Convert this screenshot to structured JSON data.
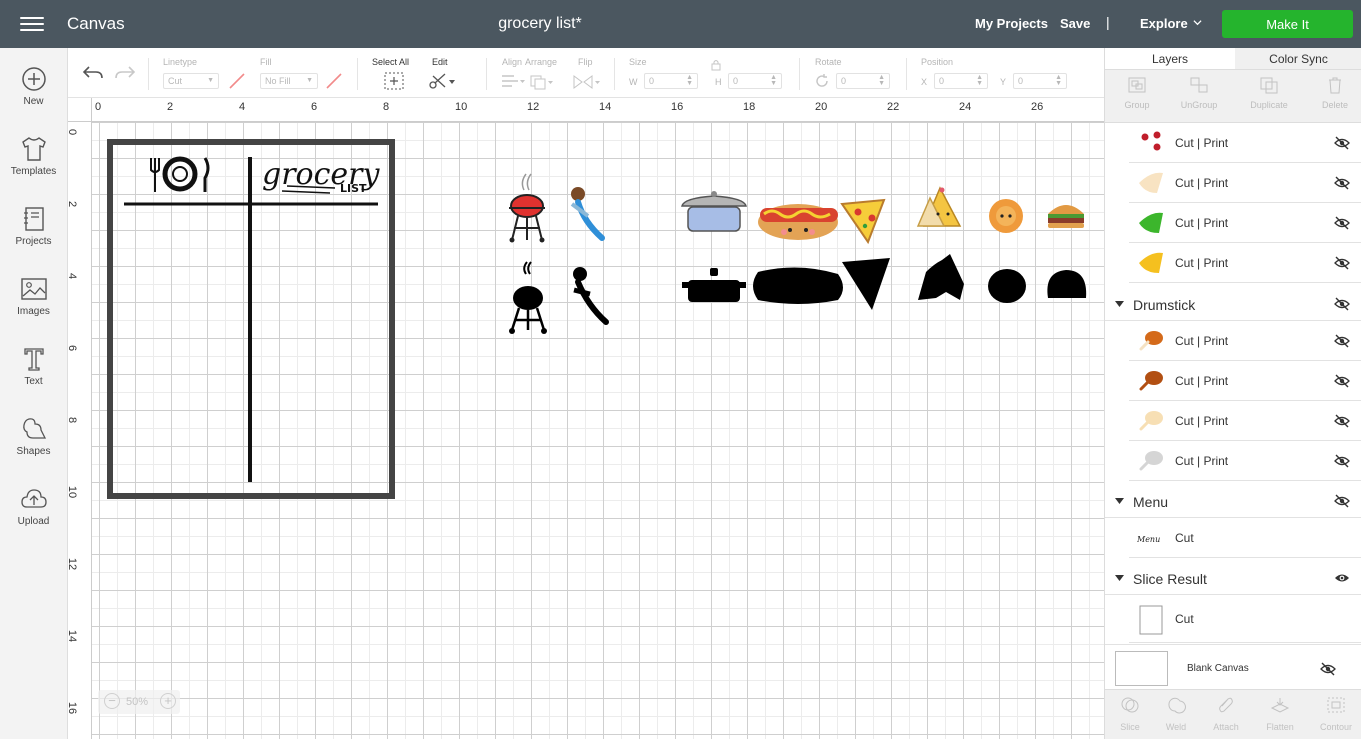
{
  "topbar": {
    "app_title": "Canvas",
    "doc_title": "grocery list*",
    "my_projects": "My Projects",
    "save": "Save",
    "separator": "|",
    "explore": "Explore",
    "make_it": "Make It",
    "make_it_color": "#25b42d",
    "bar_color": "#4b5760"
  },
  "sidebar": {
    "items": [
      {
        "label": "New",
        "icon": "plus-circle-icon"
      },
      {
        "label": "Templates",
        "icon": "tshirt-icon"
      },
      {
        "label": "Projects",
        "icon": "notebook-icon"
      },
      {
        "label": "Images",
        "icon": "image-icon"
      },
      {
        "label": "Text",
        "icon": "text-t-icon"
      },
      {
        "label": "Shapes",
        "icon": "shapes-icon"
      },
      {
        "label": "Upload",
        "icon": "cloud-upload-icon"
      }
    ]
  },
  "toolbar": {
    "linetype_label": "Linetype",
    "linetype_value": "Cut",
    "fill_label": "Fill",
    "fill_value": "No Fill",
    "select_all_label": "Select All",
    "edit_label": "Edit",
    "align_label": "Align",
    "arrange_label": "Arrange",
    "flip_label": "Flip",
    "size_label": "Size",
    "w_label": "W",
    "w_value": "0",
    "h_label": "H",
    "h_value": "0",
    "rotate_label": "Rotate",
    "rotate_value": "0",
    "position_label": "Position",
    "x_label": "X",
    "x_value": "0",
    "y_label": "Y",
    "y_value": "0"
  },
  "canvas": {
    "ruler_top": [
      "0",
      "2",
      "4",
      "6",
      "8",
      "10",
      "12",
      "14",
      "16",
      "18",
      "20",
      "22",
      "24",
      "26"
    ],
    "ruler_left": [
      "0",
      "2",
      "4",
      "6",
      "8",
      "10",
      "12",
      "14",
      "16"
    ],
    "zoom_value": "50%",
    "design": {
      "title_line1": "grocery",
      "title_line2": "LIST"
    }
  },
  "panel": {
    "tabs": [
      "Layers",
      "Color Sync"
    ],
    "actions": [
      "Group",
      "UnGroup",
      "Duplicate",
      "Delete"
    ],
    "rows": [
      {
        "type": "layer",
        "text": "Cut  | Print",
        "thumb": "red-dots"
      },
      {
        "type": "layer",
        "text": "Cut  | Print",
        "thumb": "cream-wedge"
      },
      {
        "type": "layer",
        "text": "Cut  | Print",
        "thumb": "green-wedge"
      },
      {
        "type": "layer",
        "text": "Cut  | Print",
        "thumb": "yellow-wedge"
      },
      {
        "type": "group",
        "text": "Drumstick"
      },
      {
        "type": "layer",
        "text": "Cut  | Print",
        "thumb": "drumstick-orange"
      },
      {
        "type": "layer",
        "text": "Cut  | Print",
        "thumb": "drumstick-brown"
      },
      {
        "type": "layer",
        "text": "Cut  | Print",
        "thumb": "drumstick-cream"
      },
      {
        "type": "layer",
        "text": "Cut  | Print",
        "thumb": "drumstick-grey"
      },
      {
        "type": "group",
        "text": "Menu"
      },
      {
        "type": "layer",
        "text": "Cut",
        "thumb": "menu-script"
      },
      {
        "type": "group",
        "text": "Slice Result"
      },
      {
        "type": "layer",
        "text": "Cut",
        "thumb": "white-rect"
      }
    ],
    "menu_thumb_text": "Menu",
    "blank_canvas": "Blank Canvas",
    "bottom_actions": [
      "Slice",
      "Weld",
      "Attach",
      "Flatten",
      "Contour"
    ]
  }
}
